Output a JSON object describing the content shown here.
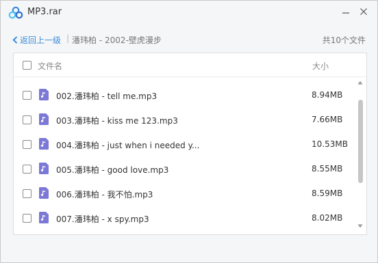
{
  "window": {
    "title": "MP3.rar",
    "brand_color": "#3b8cdc"
  },
  "nav": {
    "back_label": "返回上一级",
    "separator": "|",
    "path": "潘玮柏 - 2002-壁虎漫步",
    "count_label": "共10个文件"
  },
  "table": {
    "columns": {
      "name": "文件名",
      "size": "大小"
    },
    "rows": [
      {
        "name": "002.潘玮柏 - tell me.mp3",
        "size": "8.94MB"
      },
      {
        "name": "003.潘玮柏 - kiss me 123.mp3",
        "size": "7.66MB"
      },
      {
        "name": "004.潘玮柏 - just when i needed y...",
        "size": "10.53MB"
      },
      {
        "name": "005.潘玮柏 - good love.mp3",
        "size": "8.55MB"
      },
      {
        "name": "006.潘玮柏 - 我不怕.mp3",
        "size": "8.59MB"
      },
      {
        "name": "007.潘玮柏 - x spy.mp3",
        "size": "8.02MB"
      }
    ]
  },
  "icons": {
    "app": "cloud-logo-icon",
    "file": "music-file-icon",
    "back": "chevron-left-icon",
    "minimize": "minimize-icon",
    "close": "close-icon"
  },
  "colors": {
    "file_icon": "#7b78d6",
    "link": "#3b8cdc"
  }
}
